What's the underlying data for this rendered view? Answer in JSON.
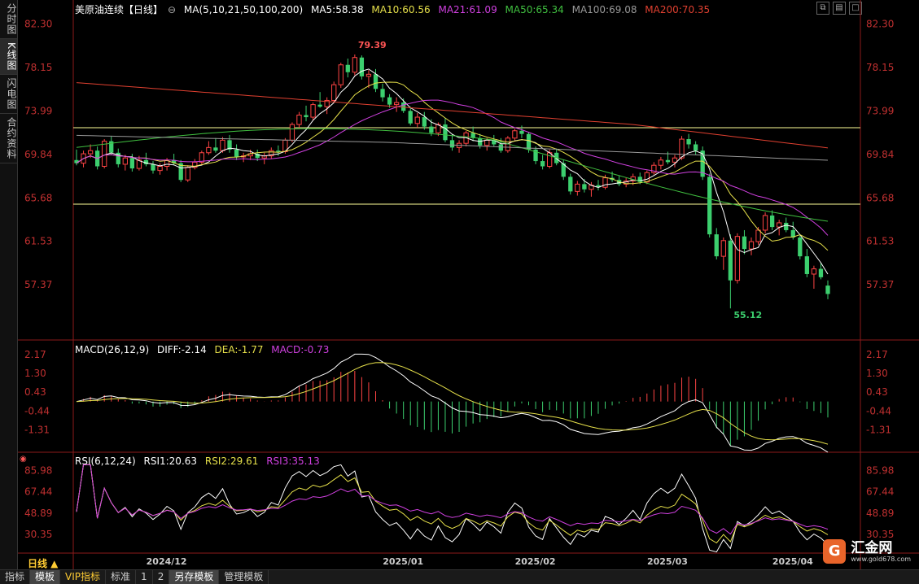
{
  "sidebar": {
    "tabs": [
      {
        "label": "分时图",
        "active": false
      },
      {
        "label": "K线图",
        "active": true
      },
      {
        "label": "闪电图",
        "active": false
      },
      {
        "label": "合约资料",
        "active": false
      }
    ]
  },
  "main_legend": {
    "title": "美原油连续【日线】",
    "ma_label": "MA(5,10,21,50,100,200)",
    "ma5": "MA5:58.38",
    "ma10": "MA10:60.56",
    "ma21": "MA21:61.09",
    "ma50": "MA50:65.34",
    "ma100": "MA100:69.08",
    "ma200": "MA200:70.35"
  },
  "macd_legend": {
    "label": "MACD(26,12,9)",
    "diff": "DIFF:-2.14",
    "dea": "DEA:-1.77",
    "macd": "MACD:-0.73"
  },
  "rsi_legend": {
    "label": "RSI(6,12,24)",
    "rsi1": "RSI1:20.63",
    "rsi2": "RSI2:29.61",
    "rsi3": "RSI3:35.13"
  },
  "colors": {
    "up": "#ff4444",
    "down": "#3ccf6e",
    "ma5": "#ffffff",
    "ma10": "#e6e04a",
    "ma21": "#d040e0",
    "ma50": "#40c040",
    "ma100": "#999999",
    "ma200": "#e04030"
  },
  "period_label": "日线 ▲",
  "bottom_tabs": [
    "指标",
    "模板",
    "VIP指标",
    "标准",
    "1",
    "2",
    "另存模板",
    "管理模板"
  ],
  "watermark": {
    "logo": "G",
    "name": "汇金网",
    "url": "www.gold678.com"
  },
  "chart_data": [
    {
      "type": "candlestick",
      "title": "美原油连续【日线】",
      "ylim": [
        53.5,
        83.2
      ],
      "y_ticks": [
        82.3,
        78.15,
        73.99,
        69.84,
        65.68,
        61.53,
        57.37
      ],
      "x_ticks": [
        "2024/12",
        "2025/01",
        "2025/02",
        "2025/03",
        "2025/04"
      ],
      "high_label": "79.39",
      "low_label": "55.12",
      "ohlc": [
        [
          69.3,
          70.3,
          68.8,
          69.0
        ],
        [
          69.0,
          70.2,
          68.6,
          69.9
        ],
        [
          69.9,
          70.8,
          69.5,
          70.2
        ],
        [
          70.2,
          70.6,
          68.4,
          68.7
        ],
        [
          68.7,
          71.3,
          68.5,
          71.1
        ],
        [
          71.1,
          71.6,
          69.8,
          70.0
        ],
        [
          70.0,
          70.4,
          68.6,
          68.9
        ],
        [
          68.9,
          69.8,
          68.3,
          69.5
        ],
        [
          69.5,
          69.9,
          68.2,
          68.5
        ],
        [
          68.5,
          69.7,
          68.3,
          69.3
        ],
        [
          69.3,
          70.0,
          68.7,
          68.9
        ],
        [
          68.9,
          69.2,
          68.0,
          68.3
        ],
        [
          68.3,
          69.0,
          67.9,
          68.7
        ],
        [
          68.7,
          69.5,
          68.3,
          69.3
        ],
        [
          69.3,
          69.9,
          68.8,
          69.0
        ],
        [
          69.0,
          69.3,
          67.2,
          67.4
        ],
        [
          67.4,
          68.8,
          67.2,
          68.6
        ],
        [
          68.6,
          69.4,
          68.4,
          69.1
        ],
        [
          69.1,
          70.2,
          68.9,
          70.0
        ],
        [
          70.0,
          71.1,
          69.8,
          70.5
        ],
        [
          70.5,
          71.4,
          70.0,
          70.2
        ],
        [
          70.2,
          71.5,
          70.0,
          71.2
        ],
        [
          71.2,
          71.7,
          70.0,
          70.3
        ],
        [
          70.3,
          70.8,
          69.3,
          69.6
        ],
        [
          69.6,
          70.0,
          69.1,
          69.7
        ],
        [
          69.7,
          70.3,
          69.3,
          69.9
        ],
        [
          69.9,
          70.3,
          69.2,
          69.5
        ],
        [
          69.5,
          70.0,
          68.9,
          69.7
        ],
        [
          69.7,
          70.5,
          69.4,
          70.2
        ],
        [
          70.2,
          70.7,
          69.7,
          70.1
        ],
        [
          70.1,
          71.4,
          69.9,
          71.2
        ],
        [
          71.2,
          72.9,
          71.0,
          72.7
        ],
        [
          72.7,
          73.9,
          72.4,
          73.6
        ],
        [
          73.6,
          74.5,
          73.0,
          73.4
        ],
        [
          73.4,
          74.8,
          73.1,
          74.6
        ],
        [
          74.6,
          75.8,
          74.3,
          74.4
        ],
        [
          74.4,
          75.3,
          73.7,
          75.0
        ],
        [
          75.0,
          76.8,
          74.8,
          76.5
        ],
        [
          76.5,
          78.6,
          76.2,
          78.4
        ],
        [
          78.4,
          79.0,
          77.2,
          77.7
        ],
        [
          77.7,
          79.39,
          77.4,
          79.1
        ],
        [
          79.1,
          79.3,
          77.0,
          77.3
        ],
        [
          77.3,
          77.9,
          76.2,
          77.5
        ],
        [
          77.5,
          78.0,
          75.8,
          76.1
        ],
        [
          76.1,
          76.6,
          74.9,
          75.3
        ],
        [
          75.3,
          75.6,
          74.3,
          74.6
        ],
        [
          74.6,
          75.3,
          73.9,
          74.8
        ],
        [
          74.8,
          75.2,
          73.8,
          74.0
        ],
        [
          74.0,
          74.4,
          72.6,
          72.8
        ],
        [
          72.8,
          73.8,
          72.4,
          73.4
        ],
        [
          73.4,
          73.9,
          72.2,
          72.5
        ],
        [
          72.5,
          73.2,
          71.6,
          71.9
        ],
        [
          71.9,
          72.9,
          71.6,
          72.7
        ],
        [
          72.7,
          73.3,
          71.0,
          71.2
        ],
        [
          71.2,
          71.8,
          70.2,
          70.5
        ],
        [
          70.5,
          71.2,
          70.0,
          70.9
        ],
        [
          70.9,
          72.1,
          70.6,
          71.9
        ],
        [
          71.9,
          72.5,
          71.1,
          71.4
        ],
        [
          71.4,
          71.8,
          70.4,
          70.7
        ],
        [
          70.7,
          71.4,
          70.2,
          71.2
        ],
        [
          71.2,
          71.7,
          70.6,
          70.8
        ],
        [
          70.8,
          71.4,
          70.0,
          70.2
        ],
        [
          70.2,
          71.6,
          70.0,
          71.4
        ],
        [
          71.4,
          72.3,
          71.2,
          72.1
        ],
        [
          72.1,
          72.6,
          71.4,
          71.8
        ],
        [
          71.8,
          72.0,
          70.0,
          70.3
        ],
        [
          70.3,
          70.6,
          68.9,
          69.2
        ],
        [
          69.2,
          69.8,
          68.4,
          68.7
        ],
        [
          68.7,
          70.3,
          68.5,
          70.0
        ],
        [
          70.0,
          70.4,
          68.8,
          69.0
        ],
        [
          69.0,
          69.3,
          67.4,
          67.7
        ],
        [
          67.7,
          68.0,
          66.0,
          66.3
        ],
        [
          66.3,
          67.3,
          65.9,
          67.0
        ],
        [
          67.0,
          67.5,
          66.2,
          66.5
        ],
        [
          66.5,
          67.2,
          65.8,
          66.9
        ],
        [
          66.9,
          67.4,
          66.4,
          66.7
        ],
        [
          66.7,
          67.9,
          66.5,
          67.6
        ],
        [
          67.6,
          68.2,
          67.2,
          67.4
        ],
        [
          67.4,
          67.8,
          66.8,
          67.0
        ],
        [
          67.0,
          67.6,
          66.7,
          67.3
        ],
        [
          67.3,
          68.0,
          66.9,
          67.7
        ],
        [
          67.7,
          68.1,
          67.0,
          67.2
        ],
        [
          67.2,
          68.3,
          67.0,
          68.1
        ],
        [
          68.1,
          69.1,
          67.9,
          68.8
        ],
        [
          68.8,
          69.6,
          68.4,
          69.3
        ],
        [
          69.3,
          70.1,
          68.9,
          69.1
        ],
        [
          69.1,
          69.8,
          68.6,
          69.5
        ],
        [
          69.5,
          71.6,
          69.3,
          71.3
        ],
        [
          71.3,
          71.8,
          70.4,
          70.8
        ],
        [
          70.8,
          71.1,
          69.8,
          70.2
        ],
        [
          70.2,
          70.6,
          67.4,
          67.7
        ],
        [
          67.7,
          68.0,
          61.9,
          62.2
        ],
        [
          62.2,
          62.8,
          59.8,
          60.1
        ],
        [
          60.1,
          61.9,
          58.8,
          61.6
        ],
        [
          61.6,
          62.2,
          55.12,
          57.8
        ],
        [
          57.8,
          62.3,
          57.5,
          62.0
        ],
        [
          62.0,
          62.6,
          60.3,
          60.8
        ],
        [
          60.8,
          61.9,
          60.2,
          61.5
        ],
        [
          61.5,
          62.9,
          61.2,
          62.6
        ],
        [
          62.6,
          64.3,
          62.3,
          64.0
        ],
        [
          64.0,
          64.5,
          62.6,
          62.9
        ],
        [
          62.9,
          63.6,
          62.1,
          63.3
        ],
        [
          63.3,
          63.8,
          62.4,
          62.6
        ],
        [
          62.6,
          63.4,
          61.7,
          61.9
        ],
        [
          61.9,
          62.2,
          59.8,
          60.1
        ],
        [
          60.1,
          60.8,
          58.1,
          58.4
        ],
        [
          58.4,
          59.2,
          57.0,
          58.9
        ],
        [
          58.9,
          59.5,
          57.9,
          58.1
        ],
        [
          57.3,
          57.8,
          56.0,
          56.5
        ]
      ]
    },
    {
      "type": "bar",
      "title": "MACD(26,12,9)",
      "ylim": [
        -2.2,
        2.4
      ],
      "y_ticks": [
        2.17,
        1.3,
        0.43,
        -0.44,
        -1.31
      ]
    },
    {
      "type": "line",
      "title": "RSI(6,12,24)",
      "ylim": [
        14,
        92
      ],
      "y_ticks": [
        85.98,
        67.44,
        48.89,
        30.35
      ]
    }
  ]
}
